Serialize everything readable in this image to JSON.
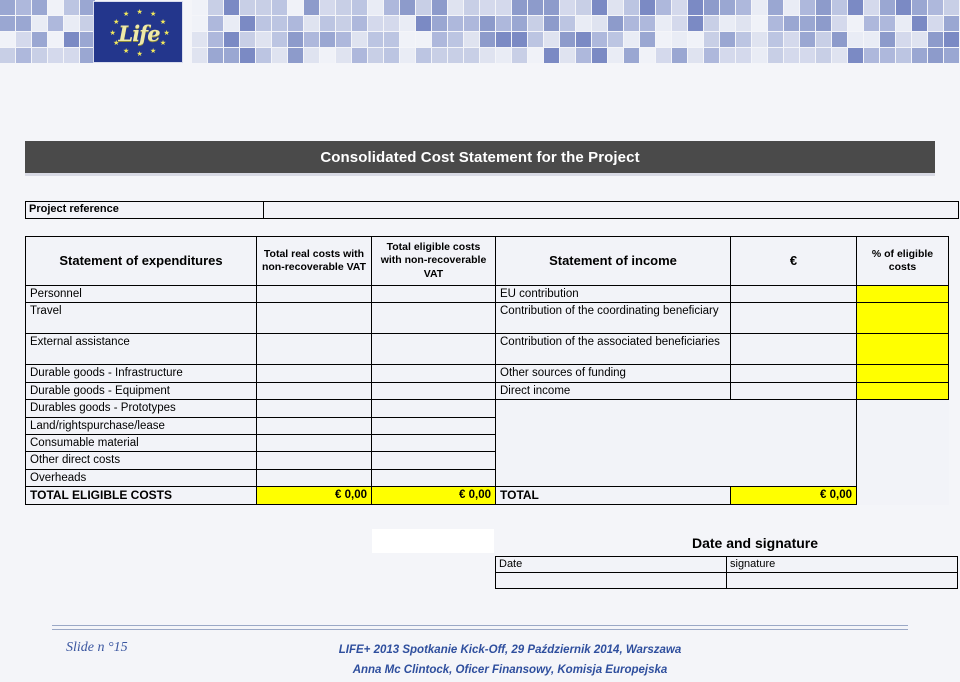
{
  "header": {
    "logo_text": "Life",
    "logo_name": "life-eu-flag-logo",
    "mosaic_colors": [
      "#c8cfe6",
      "#dfe3f0",
      "#aeb8dc",
      "#7b8ac4",
      "#e9ecf5",
      "#9aa7d2",
      "#bcc5e2",
      "#d4d9ec",
      "#8d9bcb",
      "#f0f2f8"
    ]
  },
  "title": {
    "text": "Consolidated Cost Statement for the Project"
  },
  "project_reference": {
    "label": "Project reference",
    "value": ""
  },
  "table": {
    "headers": {
      "statement_of_expenditures": "Statement of expenditures",
      "total_real_costs": "Total real costs with non-recoverable VAT",
      "total_eligible_costs": "Total eligible costs with non-recoverable VAT",
      "statement_of_income": "Statement of income",
      "euro": "€",
      "pct_eligible_costs": "% of eligible costs"
    },
    "expenditure_rows": [
      {
        "label": "Personnel",
        "real": "",
        "eligible": ""
      },
      {
        "label": "Travel",
        "real": "",
        "eligible": ""
      },
      {
        "label": "External assistance",
        "real": "",
        "eligible": ""
      },
      {
        "label": " Durable goods - Infrastructure",
        "real": "",
        "eligible": ""
      },
      {
        "label": "Durable goods - Equipment",
        "real": "",
        "eligible": ""
      },
      {
        "label": "Durables goods - Prototypes",
        "real": "",
        "eligible": ""
      },
      {
        "label": "Land/rightspurchase/lease",
        "real": "",
        "eligible": ""
      },
      {
        "label": "Consumable material",
        "real": "",
        "eligible": ""
      },
      {
        "label": "Other direct costs",
        "real": "",
        "eligible": ""
      },
      {
        "label": "Overheads",
        "real": "",
        "eligible": ""
      }
    ],
    "expenditure_total": {
      "label": "TOTAL ELIGIBLE COSTS",
      "real": "€ 0,00",
      "eligible": "€ 0,00"
    },
    "income_rows": [
      {
        "label": "EU contribution",
        "euro": "",
        "pct": ""
      },
      {
        "label": "Contribution of the coordinating beneficiary",
        "euro": "",
        "pct": ""
      },
      {
        "label": "Contribution of the associated beneficiaries",
        "euro": "",
        "pct": ""
      },
      {
        "label": "Other sources of funding",
        "euro": "",
        "pct": ""
      },
      {
        "label": "Direct income",
        "euro": "",
        "pct": ""
      }
    ],
    "income_total": {
      "label": "TOTAL",
      "euro": "€ 0,00"
    }
  },
  "signature_block": {
    "heading": "Date and signature",
    "date_label": "Date",
    "signature_label": "signature",
    "date_value": "",
    "signature_value": ""
  },
  "footer": {
    "slide_number": "Slide n °15",
    "line1": "LIFE+ 2013 Spotkanie  Kick-Off, 29 Październik 2014, Warszawa",
    "line2": "Anna Mc Clintock, Oficer Finansowy, Komisja Europejska"
  },
  "colors": {
    "banner_bg": "#4a4a4a",
    "highlight": "#ffff00",
    "page_bg": "#f4f5f9",
    "footer_text": "#2f4f9e"
  }
}
